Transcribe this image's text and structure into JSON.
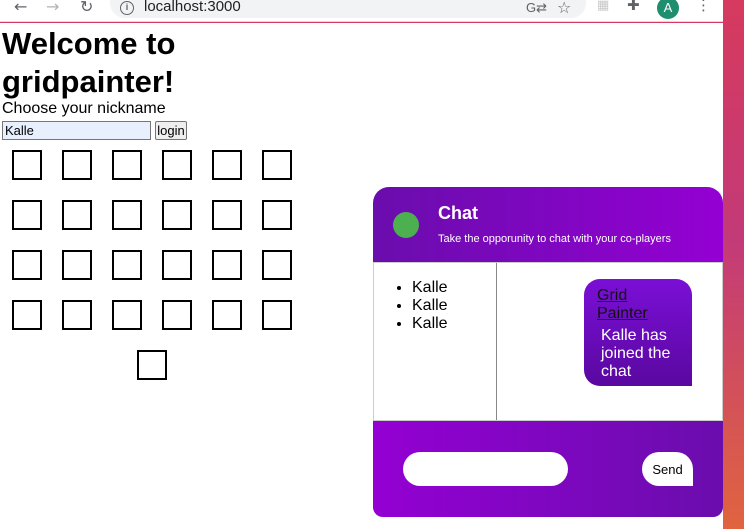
{
  "browser": {
    "url": "localhost:3000",
    "profile_initial": "A"
  },
  "page": {
    "title": "Welcome to gridpainter!",
    "nickname_label": "Choose your nickname",
    "nickname_value": "Kalle",
    "login_label": "login"
  },
  "chat": {
    "title": "Chat",
    "subtitle": "Take the opporunity to chat with your co-players",
    "status_color": "#4caf50",
    "users": [
      "Kalle",
      "Kalle",
      "Kalle"
    ],
    "messages": [
      {
        "sender": "Grid Painter",
        "text": "Kalle has joined the chat"
      }
    ],
    "input_value": "",
    "send_label": "Send"
  },
  "colors": {
    "accent_dark": "#6a0dad",
    "accent_light": "#9400d3"
  }
}
